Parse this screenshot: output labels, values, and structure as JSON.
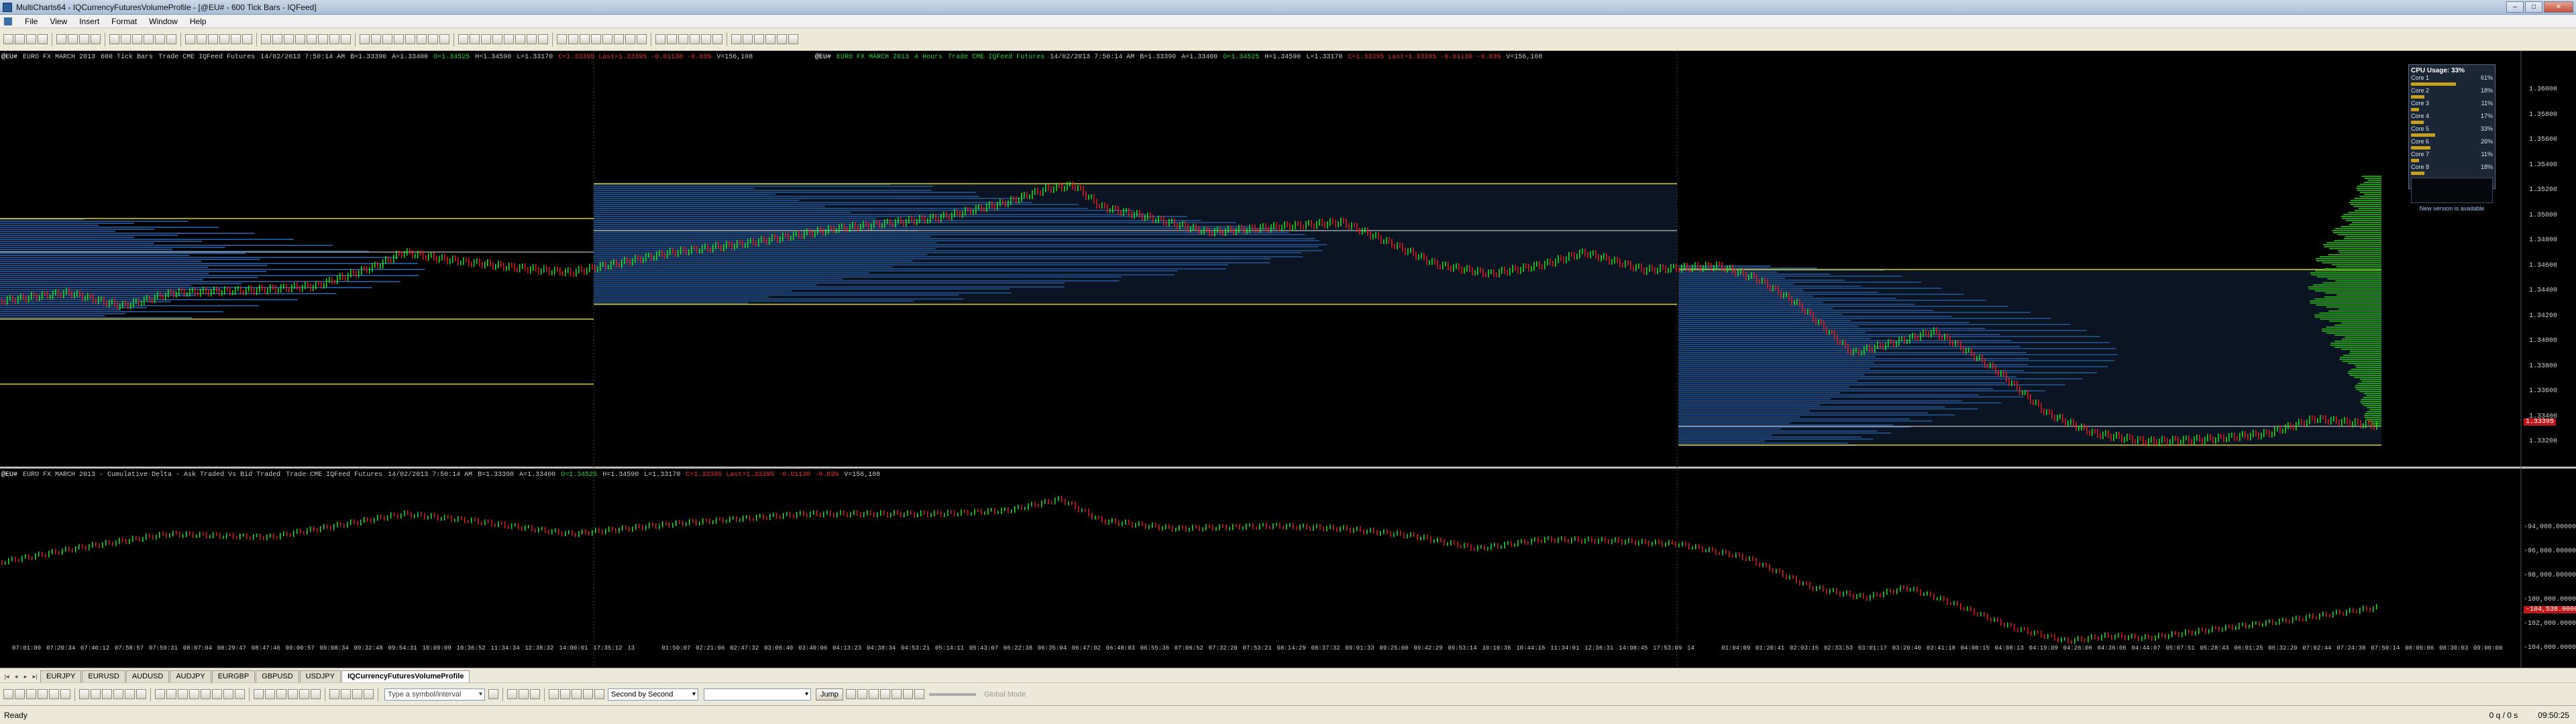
{
  "window": {
    "title": "MultiCharts64 - IQCurrencyFuturesVolumeProfile - [@EU# - 600 Tick Bars - IQFeed]"
  },
  "menu": [
    "File",
    "View",
    "Insert",
    "Format",
    "Window",
    "Help"
  ],
  "price_pane": {
    "left_info": {
      "symbol": "@EU#",
      "description": "EURO FX MARCH 2013",
      "resolution": "600 Tick Bars",
      "exchange": "Trade  CME  IQFeed  Futures",
      "datetime": "14/02/2013  7:50:14 AM",
      "bid": "B=1.33390",
      "ask": "A=1.33400",
      "open": "O=1.34525",
      "high": "H=1.34590",
      "low": "L=1.33170",
      "close": "C=1.33395  Last=1.33395  -0.01130  -0.83%",
      "volume": "V=156,108"
    },
    "right_info": {
      "symbol": "@EU#",
      "description": "EURO FX MARCH 2013",
      "resolution": "4 Hours",
      "exchange": "Trade  CME  IQFeed  Futures",
      "datetime": "14/02/2013  7:50:14 AM",
      "bid": "B=1.33390",
      "ask": "A=1.33400",
      "open": "O=1.34525",
      "high": "H=1.34590",
      "low": "L=1.33170",
      "close": "C=1.33395  Last=1.33395  -0.01130  -0.83%",
      "volume": "V=156,108"
    },
    "axis_labels": [
      "1.36000",
      "1.35800",
      "1.35600",
      "1.35400",
      "1.35200",
      "1.35000",
      "1.34800",
      "1.34600",
      "1.34400",
      "1.34200",
      "1.34000",
      "1.33800",
      "1.33600",
      "1.33400",
      "1.33200"
    ],
    "last_price_tag": "1.33395"
  },
  "delta_pane": {
    "info": {
      "symbol": "@EU#",
      "description": "EURO FX MARCH 2013 - Cumulative Delta - Ask Traded Vs Bid Traded",
      "exchange": "Trade  CME  IQFeed  Futures",
      "datetime": "14/02/2013  7:50:14 AM",
      "bid": "B=1.33390",
      "ask": "A=1.33400",
      "open": "O=1.34525",
      "high": "H=1.34590",
      "low": "L=1.33170",
      "close": "C=1.33395  Last=1.33395  -0.01130  -0.83%",
      "volume": "V=156,108"
    },
    "axis_labels": [
      "-94,000.00000",
      "-96,000.00000",
      "-98,000.00000",
      "-100,000.00000",
      "-102,000.00000",
      "-104,000.00000",
      "-106,000.00000"
    ],
    "last_value_tag": "-104,538.00000"
  },
  "time_axis": [
    "07:01:00",
    "07:20:34",
    "07:40:12",
    "07:58:57",
    "07:59:31",
    "08:07:04",
    "08:29:47",
    "08:47:46",
    "09:00:57",
    "09:08:34",
    "09:32:48",
    "09:54:31",
    "10:09:09",
    "10:36:52",
    "11:34:34",
    "12:38:32",
    "14:00:01",
    "17:35:12",
    "13",
    "01:50:07",
    "02:21:06",
    "02:47:32",
    "03:06:40",
    "03:40:06",
    "04:13:23",
    "04:38:34",
    "04:53:21",
    "05:14:11",
    "05:43:07",
    "06:22:38",
    "06:35:04",
    "06:47:02",
    "06:48:03",
    "06:55:36",
    "07:06:52",
    "07:32:20",
    "07:53:21",
    "08:14:29",
    "08:37:32",
    "09:01:33",
    "09:25:00",
    "09:42:29",
    "09:53:14",
    "10:10:36",
    "10:44:16",
    "11:34:01",
    "12:36:31",
    "14:08:45",
    "17:53:09",
    "14",
    "01:04:09",
    "01:20:41",
    "02:03:15",
    "02:33:53",
    "03:01:17",
    "03:20:40",
    "03:41:18",
    "04:00:15",
    "04:08:13",
    "04:19:09",
    "04:26:06",
    "04:36:06",
    "04:44:07",
    "05:07:51",
    "05:28:43",
    "06:01:25",
    "06:32:20",
    "07:02:44",
    "07:24:38",
    "07:50:14",
    "08:00:06",
    "08:30:03",
    "09:00:00"
  ],
  "cpu_widget": {
    "title": "CPU Usage: 33%",
    "rows": [
      {
        "label": "Core 1",
        "value": "61%"
      },
      {
        "label": "Core 2",
        "value": "18%"
      },
      {
        "label": "Core 3",
        "value": "11%"
      },
      {
        "label": "Core 4",
        "value": "17%"
      },
      {
        "label": "Core 5",
        "value": "33%"
      },
      {
        "label": "Core 6",
        "value": "26%"
      },
      {
        "label": "Core 7",
        "value": "11%"
      },
      {
        "label": "Core 8",
        "value": "18%"
      }
    ],
    "footer": "New version is available"
  },
  "workspace_tabs": [
    "EURJPY",
    "EURUSD",
    "AUDUSD",
    "AUDJPY",
    "EURGBP",
    "GBPUSD",
    "USDJPY",
    "IQCurrencyFuturesVolumeProfile"
  ],
  "active_tab": "IQCurrencyFuturesVolumeProfile",
  "drawbar": {
    "symbol_input_placeholder": "Type a symbol/interval",
    "replay_mode": "Second by Second",
    "jump_label": "Jump",
    "global_mode_label": "Global Mode"
  },
  "status": {
    "left": "Ready",
    "queue": "0 q / 0 s",
    "clock": "09:50:25"
  },
  "colors": {
    "up_bar": "#22e01e",
    "down_bar": "#e01e1e",
    "profile": "#1f4f8a",
    "value_area_line": "#d8d02a",
    "green_profile": "#1e9a18"
  }
}
